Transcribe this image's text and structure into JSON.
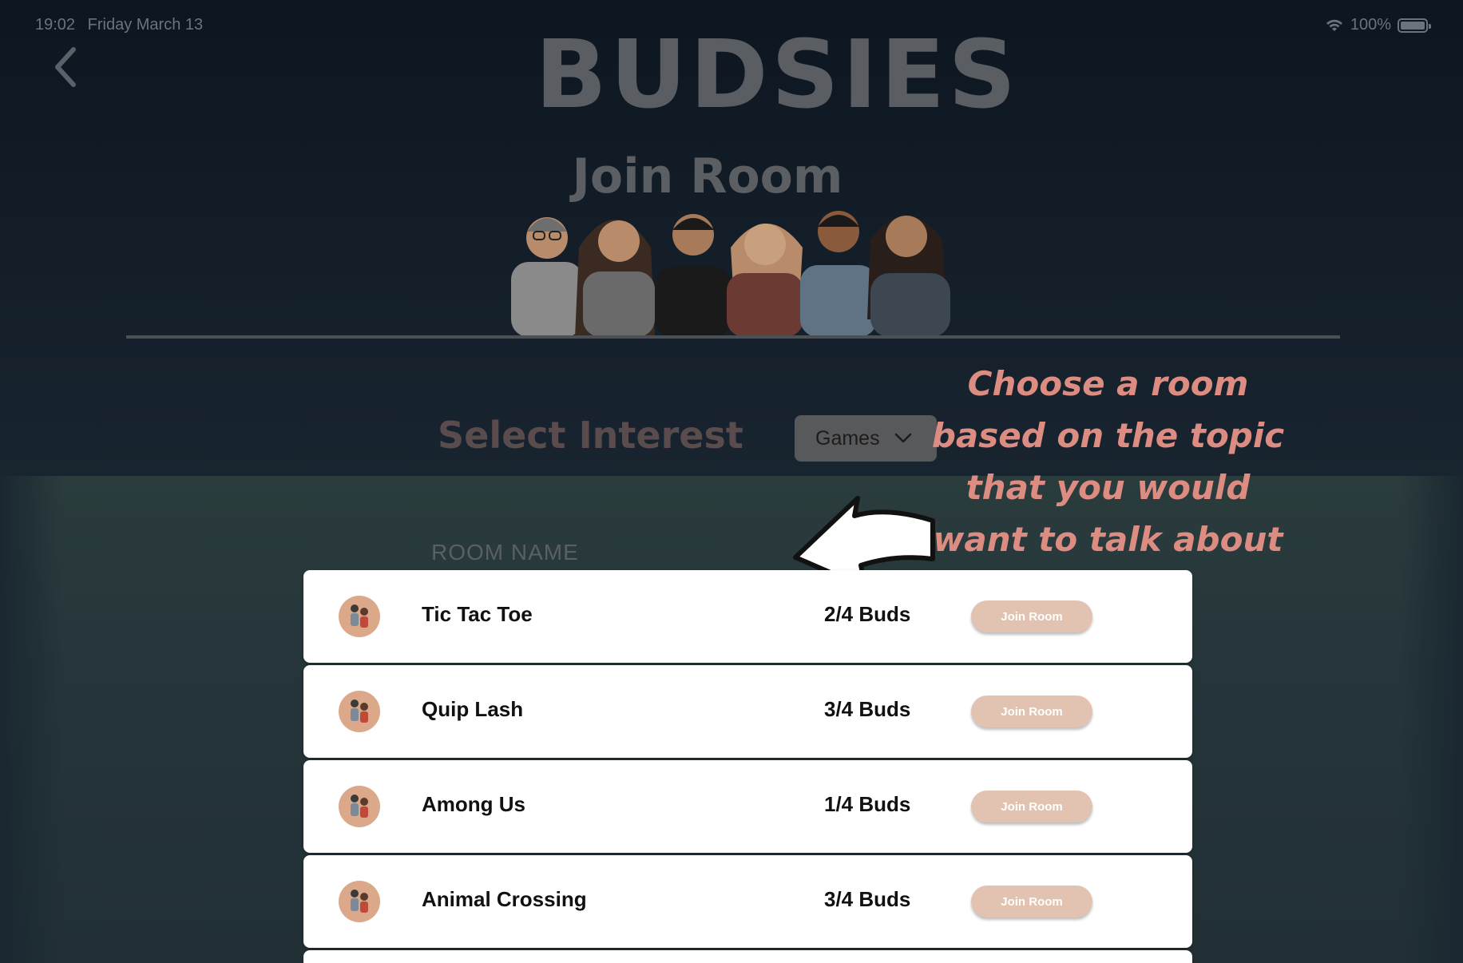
{
  "status": {
    "time": "19:02",
    "date": "Friday March 13",
    "battery": "100%"
  },
  "header": {
    "logo": "BUDSIES",
    "title": "Join Room"
  },
  "filter": {
    "label": "Select Interest",
    "selected": "Games"
  },
  "callout": {
    "text": "Choose a room based on the topic that you would want to talk about"
  },
  "table": {
    "column_room_name": "ROOM NAME"
  },
  "rooms": [
    {
      "name": "Tic Tac Toe",
      "count": "2/4 Buds",
      "action": "Join Room"
    },
    {
      "name": "Quip Lash",
      "count": "3/4 Buds",
      "action": "Join Room"
    },
    {
      "name": "Among Us",
      "count": "1/4 Buds",
      "action": "Join Room"
    },
    {
      "name": "Animal Crossing",
      "count": "3/4 Buds",
      "action": "Join Room"
    }
  ],
  "colors": {
    "callout": "#dd8c82",
    "join_button": "#e2c3b1",
    "avatar_bg": "#dba88a"
  }
}
